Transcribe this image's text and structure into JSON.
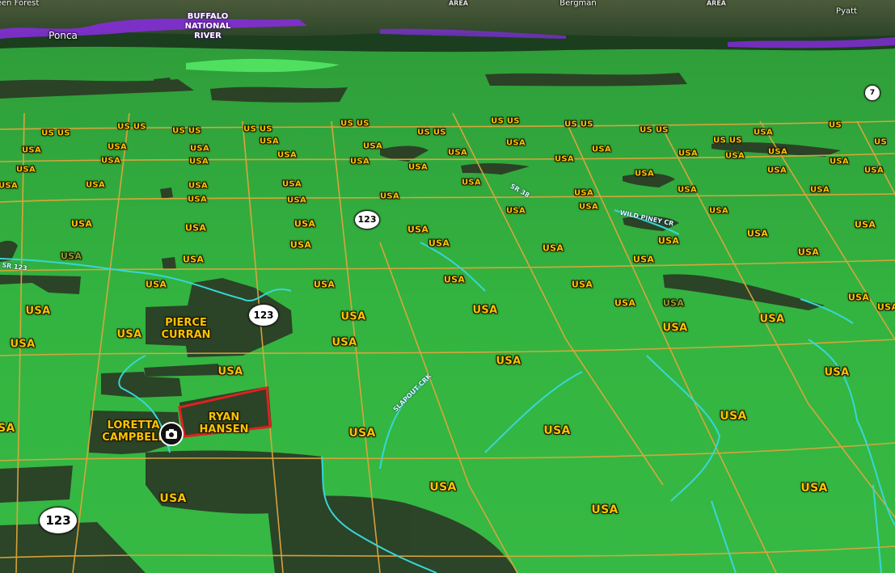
{
  "map": {
    "colors": {
      "land": "#32b53f",
      "private": "#2b3c26",
      "boundary": "#e0a53c",
      "stream": "#38d6d6",
      "park": "#8a2be2",
      "selected": "#e02020"
    },
    "top_labels": {
      "forest_fragment": "een Forest",
      "town_ponca": "Ponca",
      "area_1": "AREA",
      "town_bergman": "Bergman",
      "area_2": "AREA",
      "town_pyatt": "Pyatt",
      "park_name": "BUFFALO\nNATIONAL\nRIVER"
    },
    "highways": [
      {
        "id": "hwy-7",
        "text": "7"
      },
      {
        "id": "hwy-123-a",
        "text": "123"
      },
      {
        "id": "hwy-123-b",
        "text": "123"
      },
      {
        "id": "hwy-123-c",
        "text": "123"
      }
    ],
    "owners": {
      "pierce_curran": "PIERCE\nCURRAN",
      "loretta_campbell": "LORETTA\nCAMPBELL",
      "ryan_hansen": "RYAN\nHANSEN"
    },
    "roads": {
      "road_a": "SR 38",
      "road_b": "WILD PINEY CR",
      "road_c": "SR 123",
      "road_d": "SLAPOUT CRK"
    },
    "usus_label": "US US",
    "us_label": "US",
    "usa_label": "USA",
    "camera_icon": "camera-icon"
  }
}
